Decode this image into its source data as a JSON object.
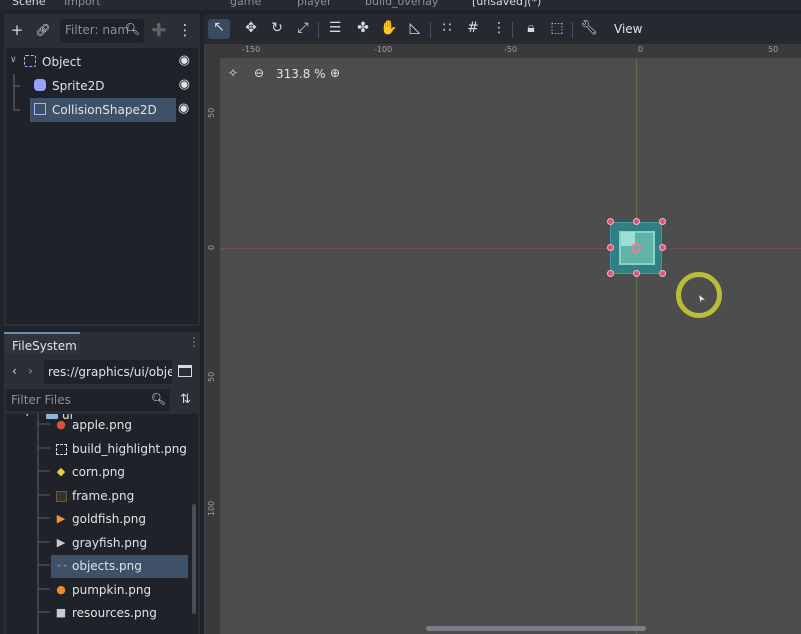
{
  "top_tabs": {
    "scene_tab": "Scene",
    "import_tab": "Import",
    "editor_tabs": [
      "game",
      "player",
      "build_overlay",
      "[unsaved](*)"
    ]
  },
  "scene": {
    "filter_placeholder": "Filter: nam",
    "nodes": [
      {
        "label": "Object",
        "icon": "node2d-icon"
      },
      {
        "label": "Sprite2D",
        "icon": "sprite2d-icon"
      },
      {
        "label": "CollisionShape2D",
        "icon": "collisionshape2d-icon",
        "selected": true
      }
    ]
  },
  "filesystem": {
    "tab_label": "FileSystem",
    "path": "res://graphics/ui/obje",
    "filter_placeholder": "Filter Files",
    "folder": "ui",
    "files": [
      {
        "name": "apple.png",
        "icon": "apple-icon"
      },
      {
        "name": "build_highlight.png",
        "icon": "highlight-icon"
      },
      {
        "name": "corn.png",
        "icon": "corn-icon"
      },
      {
        "name": "frame.png",
        "icon": "frame-icon"
      },
      {
        "name": "goldfish.png",
        "icon": "goldfish-icon"
      },
      {
        "name": "grayfish.png",
        "icon": "grayfish-icon"
      },
      {
        "name": "objects.png",
        "icon": "objects-icon",
        "selected": true
      },
      {
        "name": "pumpkin.png",
        "icon": "pumpkin-icon"
      },
      {
        "name": "resources.png",
        "icon": "resources-icon"
      }
    ]
  },
  "viewport": {
    "view_menu": "View",
    "zoom_label": "313.8 %",
    "ruler_top": [
      "-150",
      "-100",
      "-50",
      "0",
      "50"
    ],
    "ruler_left": [
      "50",
      "0",
      "50",
      "100"
    ]
  },
  "colors": {
    "selection": "#3f5166",
    "accent": "#6c8fb9",
    "handle": "#e0507a",
    "cursor_ring": "#b8bd3a"
  }
}
